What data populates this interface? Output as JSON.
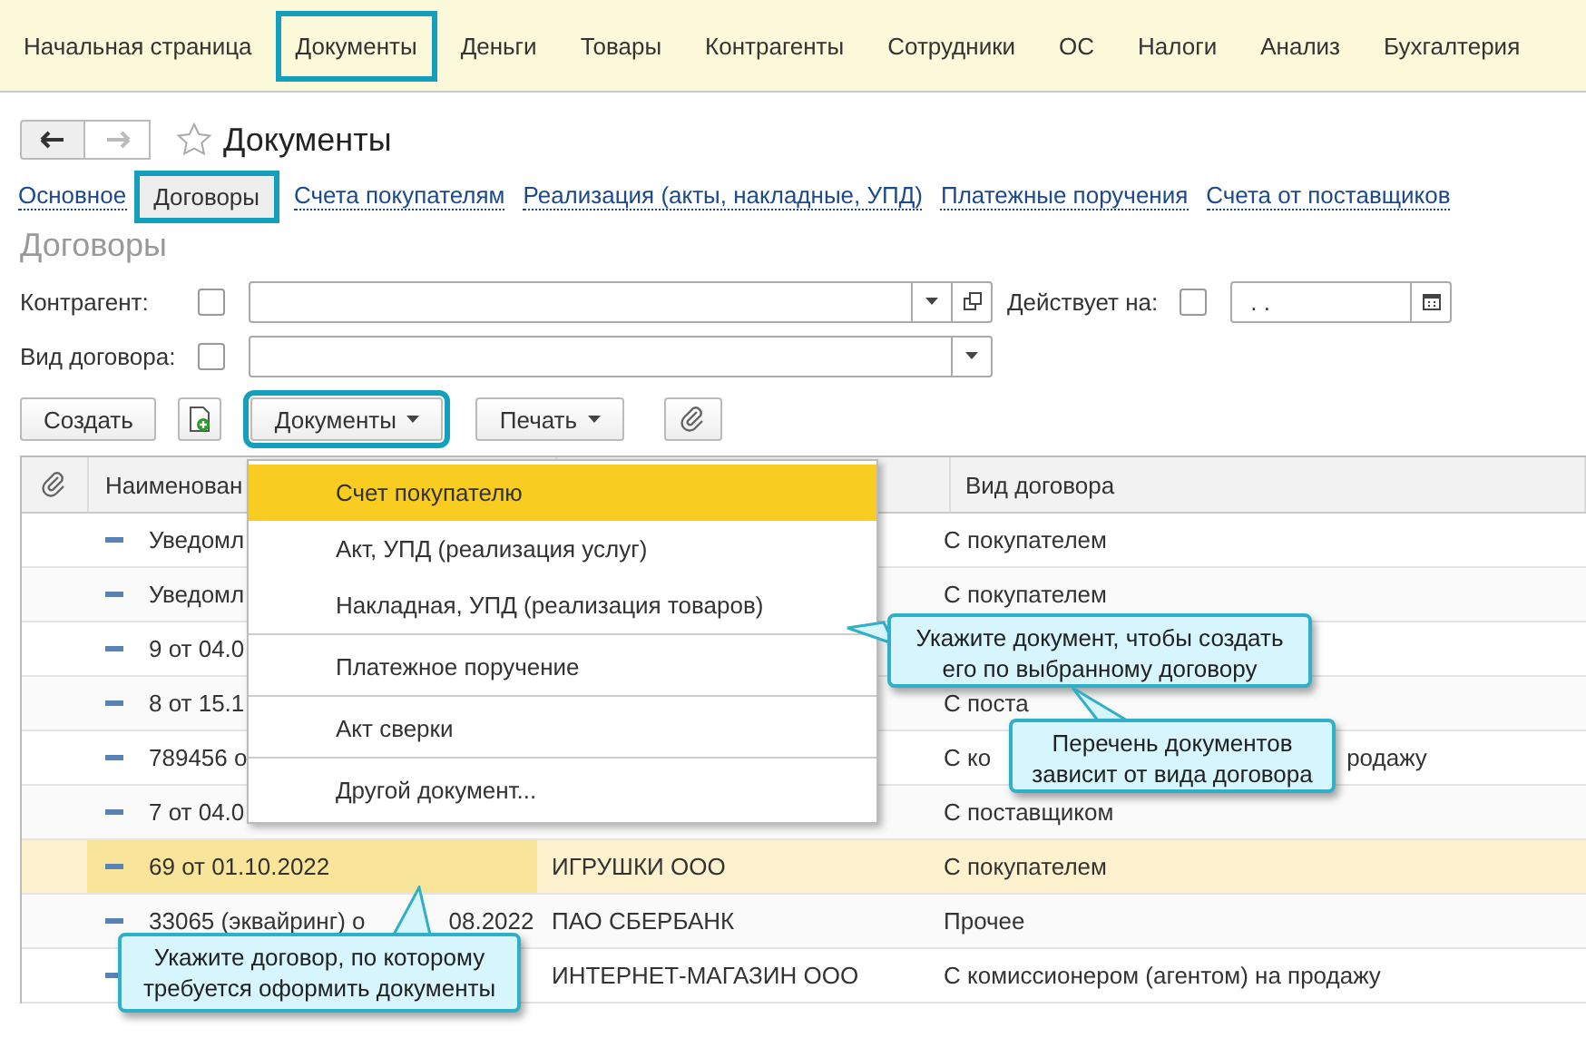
{
  "top_menu": [
    {
      "label": "Начальная страница",
      "selected": false
    },
    {
      "label": "Документы",
      "selected": true
    },
    {
      "label": "Деньги",
      "selected": false
    },
    {
      "label": "Товары",
      "selected": false
    },
    {
      "label": "Контрагенты",
      "selected": false
    },
    {
      "label": "Сотрудники",
      "selected": false
    },
    {
      "label": "ОС",
      "selected": false
    },
    {
      "label": "Налоги",
      "selected": false
    },
    {
      "label": "Анализ",
      "selected": false
    },
    {
      "label": "Бухгалтерия",
      "selected": false
    }
  ],
  "page_title": "Документы",
  "tabs": [
    {
      "label": "Основное",
      "selected": false
    },
    {
      "label": "Договоры",
      "selected": true
    },
    {
      "label": "Счета покупателям",
      "selected": false
    },
    {
      "label": "Реализация (акты, накладные, УПД)",
      "selected": false
    },
    {
      "label": "Платежные поручения",
      "selected": false
    },
    {
      "label": "Счета от поставщиков",
      "selected": false
    }
  ],
  "section_title": "Договоры",
  "filters": {
    "counterparty": {
      "label": "Контрагент:",
      "checked": false
    },
    "valid_on": {
      "label": "Действует на:",
      "checked": false,
      "value": " .  ."
    },
    "contract_type": {
      "label": "Вид договора:",
      "checked": false
    }
  },
  "toolbar": {
    "create": "Создать",
    "documents": {
      "label": "Документы",
      "highlighted": true
    },
    "print": "Печать"
  },
  "table": {
    "columns": [
      "Наименован",
      "Вид договора"
    ],
    "rows": [
      {
        "name": [
          "Уведомл"
        ],
        "counterparty": "",
        "type": [
          "С покупателем"
        ],
        "selected": false
      },
      {
        "name": [
          "Уведомл"
        ],
        "counterparty": "",
        "type": [
          "С покупателем"
        ],
        "selected": false
      },
      {
        "name": [
          "9 от 04.0"
        ],
        "counterparty": "",
        "type": [],
        "selected": false
      },
      {
        "name": [
          "8 от 15.1"
        ],
        "counterparty": "",
        "type": [
          "С поста"
        ],
        "selected": false
      },
      {
        "name": [
          "789456 о"
        ],
        "counterparty": "",
        "type": [
          "С ко",
          "родажу"
        ],
        "selected": false
      },
      {
        "name": [
          "7 от 04.0"
        ],
        "counterparty": "",
        "type": [
          "С поставщиком"
        ],
        "selected": false
      },
      {
        "name": [
          "69 от 01.10.2022"
        ],
        "counterparty": "ИГРУШКИ ООО",
        "type": [
          "С покупателем"
        ],
        "selected": true
      },
      {
        "name": [
          "33065 (эквайринг) о",
          "08.2022"
        ],
        "counterparty": "ПАО СБЕРБАНК",
        "type": [
          "Прочее"
        ],
        "selected": false
      },
      {
        "name": [],
        "counterparty": "ИНТЕРНЕТ-МАГАЗИН ООО",
        "type": [
          "С комиссионером (агентом) на продажу"
        ],
        "selected": false
      }
    ]
  },
  "dropdown_menu": [
    {
      "label": "Счет покупателю",
      "selected": true,
      "separator_after": false
    },
    {
      "label": "Акт, УПД (реализация услуг)",
      "selected": false,
      "separator_after": false
    },
    {
      "label": "Накладная, УПД (реализация товаров)",
      "selected": false,
      "separator_after": true
    },
    {
      "label": "Платежное поручение",
      "selected": false,
      "separator_after": true
    },
    {
      "label": "Акт сверки",
      "selected": false,
      "separator_after": true
    },
    {
      "label": "Другой документ...",
      "selected": false,
      "separator_after": false
    }
  ],
  "callouts": [
    {
      "kind": "menu",
      "text": "Укажите документ, чтобы создать его по выбранному договору"
    },
    {
      "kind": "list",
      "text": "Перечень документов зависит от вида договора"
    },
    {
      "kind": "row",
      "text": "Укажите договор, по которому требуется оформить документы"
    }
  ]
}
